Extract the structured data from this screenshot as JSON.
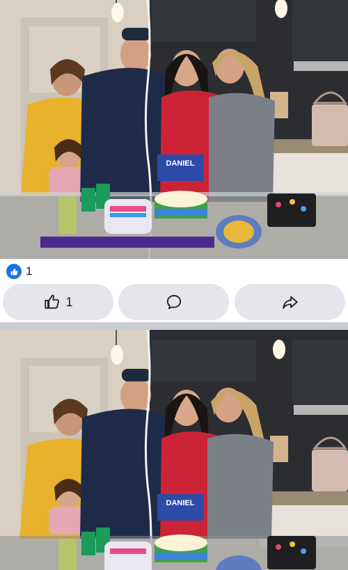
{
  "post": {
    "reaction_summary": {
      "icon": "like-icon",
      "count": "1",
      "badge_color": "#1b74e4"
    },
    "actions": {
      "like": {
        "icon": "thumbs-up-icon",
        "count": "1"
      },
      "comment": {
        "icon": "comment-bubble-icon"
      },
      "share": {
        "icon": "share-arrow-icon"
      }
    },
    "photo": {
      "cake_topper_text": "DANIEL"
    }
  },
  "colors": {
    "button_bg": "#e4e6eb",
    "divider": "#c9ccd1",
    "text": "#1c1e21"
  }
}
